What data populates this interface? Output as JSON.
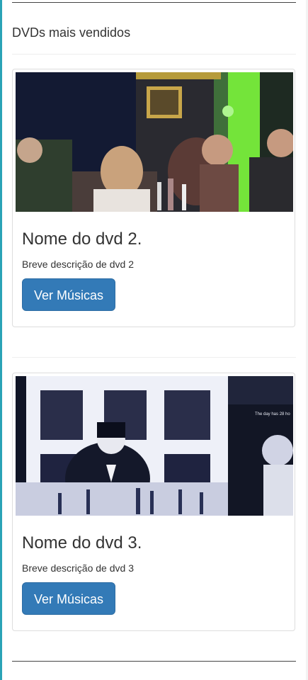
{
  "section": {
    "title": "DVDs mais vendidos"
  },
  "cards": [
    {
      "title": "Nome do dvd 2.",
      "description": "Breve descrição de dvd 2",
      "button_label": "Ver Músicas"
    },
    {
      "title": "Nome do dvd 3.",
      "description": "Breve descrição de dvd 3",
      "button_label": "Ver Músicas",
      "image_sign_text": "The day has 28 ho"
    }
  ]
}
